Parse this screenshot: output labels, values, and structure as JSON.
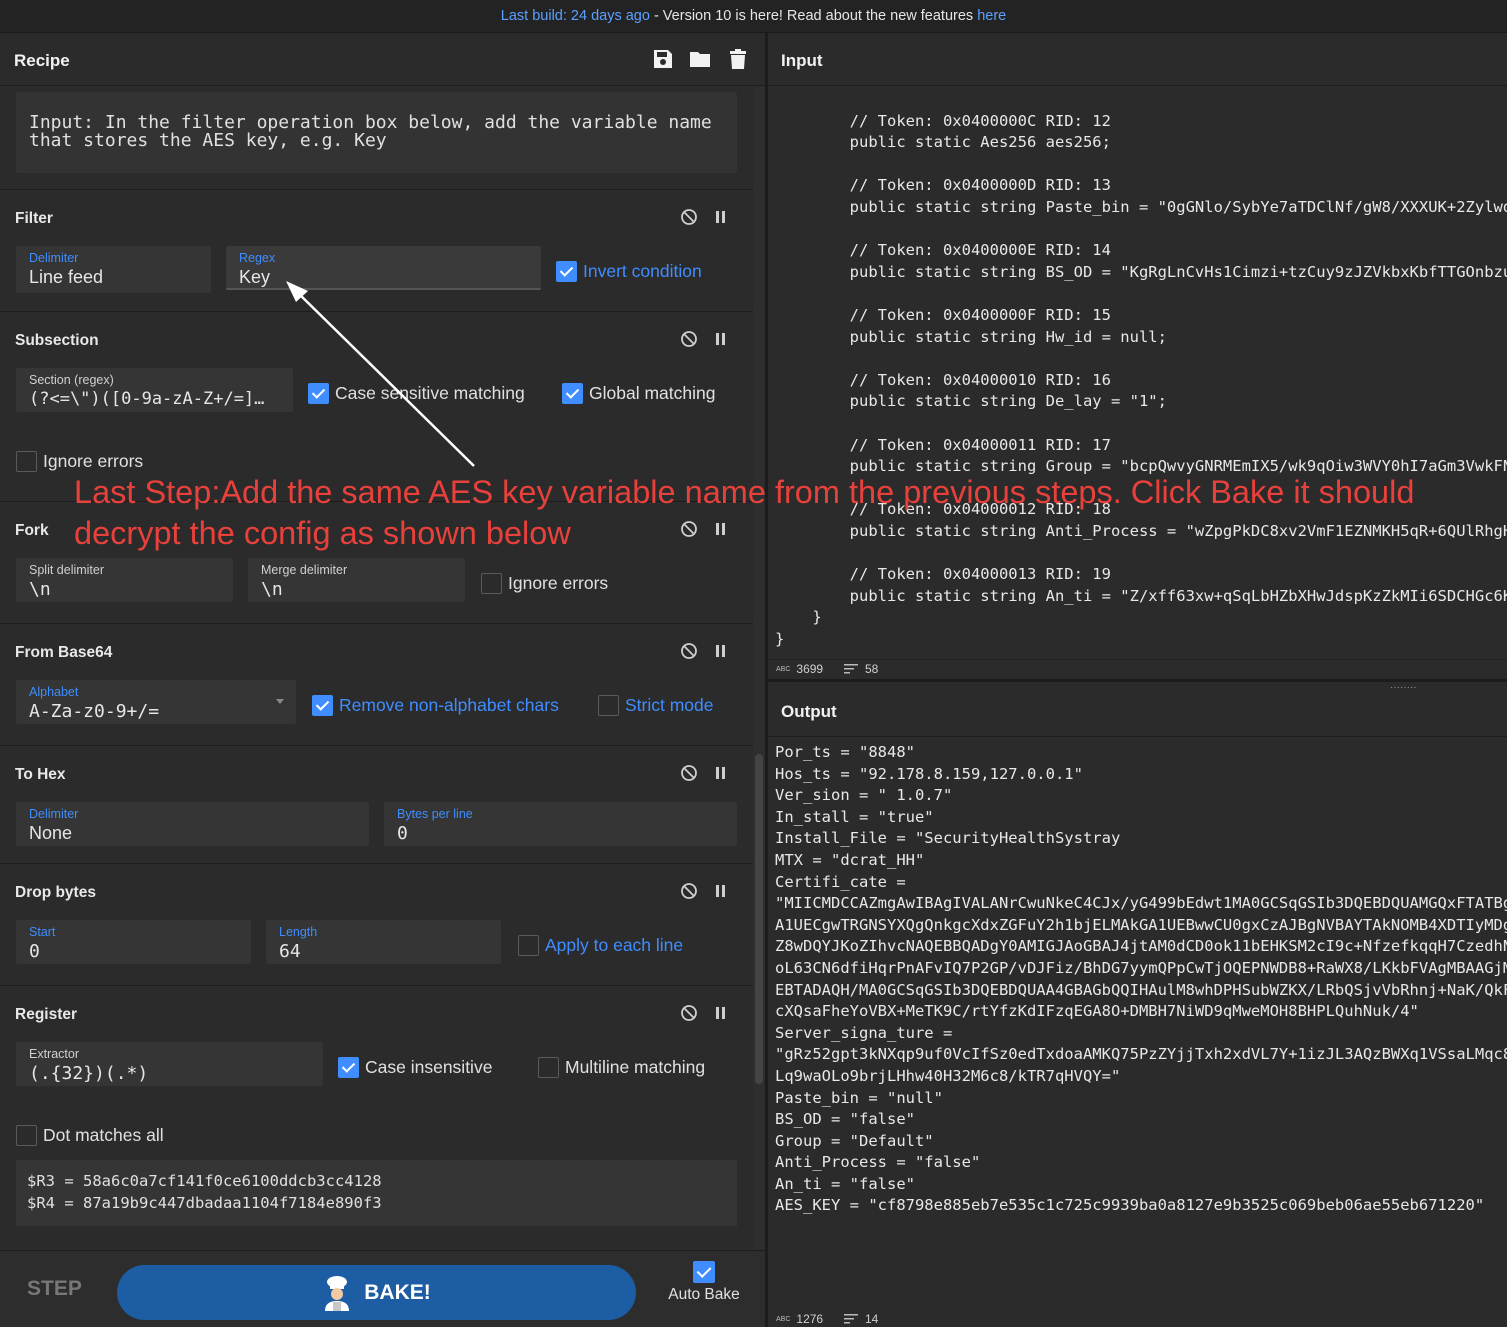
{
  "banner": {
    "last_build": "Last build: 24 days ago",
    "middle": " - Version 10 is here! Read about the new features ",
    "here": "here"
  },
  "recipe": {
    "title": "Recipe",
    "note": "Input: In the filter operation box below, add the variable name\nthat stores the AES key, e.g. Key",
    "filter": {
      "title": "Filter",
      "delimiter_label": "Delimiter",
      "delimiter_value": "Line feed",
      "regex_label": "Regex",
      "regex_value": "Key",
      "invert_label": "Invert condition"
    },
    "subsection": {
      "title": "Subsection",
      "section_label": "Section (regex)",
      "section_value": "(?<=\\\")([0-9a-zA-Z+/=]…",
      "case_label": "Case sensitive matching",
      "global_label": "Global matching",
      "ignore_label": "Ignore errors"
    },
    "fork": {
      "title": "Fork",
      "split_label": "Split delimiter",
      "split_value": "\\n",
      "merge_label": "Merge delimiter",
      "merge_value": "\\n",
      "ignore_label": "Ignore errors"
    },
    "from_base64": {
      "title": "From Base64",
      "alphabet_label": "Alphabet",
      "alphabet_value": "A-Za-z0-9+/=",
      "remove_label": "Remove non-alphabet chars",
      "strict_label": "Strict mode"
    },
    "to_hex": {
      "title": "To Hex",
      "delimiter_label": "Delimiter",
      "delimiter_value": "None",
      "bytes_label": "Bytes per line",
      "bytes_value": "0"
    },
    "drop_bytes": {
      "title": "Drop bytes",
      "start_label": "Start",
      "start_value": "0",
      "length_label": "Length",
      "length_value": "64",
      "apply_label": "Apply to each line"
    },
    "register": {
      "title": "Register",
      "extractor_label": "Extractor",
      "extractor_value": "(.{32})(.*)",
      "case_label": "Case insensitive",
      "multiline_label": "Multiline matching",
      "dotall_label": "Dot matches all",
      "output": "$R3 = 58a6c0a7cf141f0ce6100ddcb3cc4128\n$R4 = 87a19b9c447dbadaa1104f7184e890f3"
    }
  },
  "controls": {
    "step": "STEP",
    "bake": "BAKE!",
    "auto_bake": "Auto Bake"
  },
  "input": {
    "title": "Input",
    "code": "                                              \n        // Token: 0x0400000C RID: 12\n        public static Aes256 aes256;\n\n        // Token: 0x0400000D RID: 13\n        public static string Paste_bin = \"0gGNlo/SybYe7aTDClNf/gW8/XXXUK+2Zylwd\n\n        // Token: 0x0400000E RID: 14\n        public static string BS_OD = \"KgRgLnCvHs1Cimzi+tzCuy9zJZVkbxKbfTTGOnbzu\n\n        // Token: 0x0400000F RID: 15\n        public static string Hw_id = null;\n\n        // Token: 0x04000010 RID: 16\n        public static string De_lay = \"1\";\n\n        // Token: 0x04000011 RID: 17\n        public static string Group = \"bcpQwvyGNRMEmIX5/wk9qOiw3WVY0hI7aGm3VwkFN\n\n        // Token: 0x04000012 RID: 18\n        public static string Anti_Process = \"wZpgPkDC8xv2VmF1EZNMKH5qR+6QUlRhgH\n\n        // Token: 0x04000013 RID: 19\n        public static string An_ti = \"Z/xff63xw+qSqLbHZbXHwJdspKzZkMIi6SDCHGc6K\n    }\n}",
    "length": "3699",
    "lines": "58"
  },
  "output": {
    "title": "Output",
    "code": "Por_ts = \"8848\"\nHos_ts = \"92.178.8.159,127.0.0.1\"\nVer_sion = \" 1.0.7\"\nIn_stall = \"true\"\nInstall_File = \"SecurityHealthSystray\nMTX = \"dcrat_HH\"\nCertifi_cate =\n\"MIICMDCCAZmgAwIBAgIVALANrCwuNkeC4CJx/yG499bEdwt1MA0GCSqGSIb3DQEBDQUAMGQxFTATBg\nA1UECgwTRGNSYXQgQnkgcXdxZGFuY2h1bjELMAkGA1UEBwwCU0gxCzAJBgNVBAYTAkNOMB4XDTIyMDg\nZ8wDQYJKoZIhvcNAQEBBQADgY0AMIGJAoGBAJ4jtAM0dCD0ok11bEHKSM2cI9c+NfzefkqqH7CzedhN\noL63CN6dfiHqrPnAFvIQ7P2GP/vDJFiz/BhDG7yymQPpCwTjOQEPNWDB8+RaWX8/LKkbFVAgMBAAGjM\nEBTADAQH/MA0GCSqGSIb3DQEBDQUAA4GBAGbQQIHAulM8whDPHSubWZKX/LRbQSjvVbRhnj+NaK/QkF\ncXQsaFheYoVBX+MeTK9C/rtYfzKdIFzqEGA8O+DMBH7NiWD9qMweMOH8BHPLQuhNuk/4\"\nServer_signa_ture =\n\"gRz52gpt3kNXqp9uf0VcIfSz0edTxdoaAMKQ75PzZYjjTxh2xdVL7Y+1izJL3AQzBWXq1VSsaLMqc8\nLq9waOLo9brjLHhw40H32M6c8/kTR7qHVQY=\"\nPaste_bin = \"null\"\nBS_OD = \"false\"\nGroup = \"Default\"\nAnti_Process = \"false\"\nAn_ti = \"false\"\nAES_KEY = \"cf8798e885eb7e535c1c725c9939ba0a8127e9b3525c069beb06ae55eb671220\"",
    "length": "1276",
    "lines": "14"
  },
  "annotation": {
    "line1": "Last Step:Add the same AES key variable name from the previous steps. Click Bake it should",
    "line2": "decrypt the config as shown below"
  },
  "colors": {
    "accent": "#3f8dff",
    "bake": "#1c5da3",
    "annotation": "#e8413c",
    "panel": "#2b2b2b"
  },
  "icons": {
    "save": "floppy-disk-icon",
    "folder": "folder-icon",
    "trash": "trash-icon",
    "disable": "circle-slash-icon",
    "pause": "pause-icon",
    "chef": "chef-icon"
  }
}
